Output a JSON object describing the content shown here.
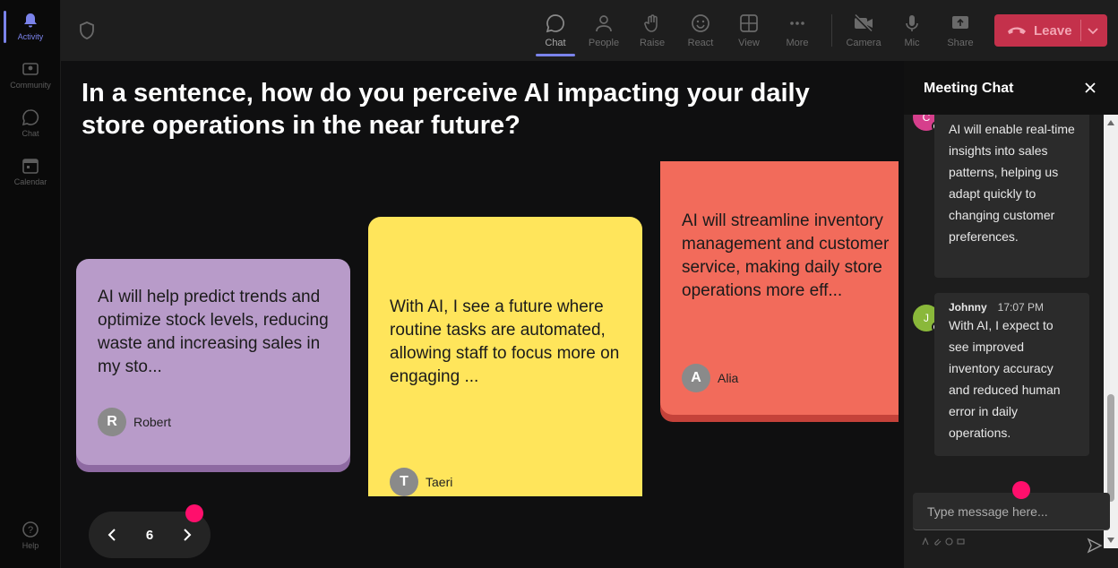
{
  "rail": {
    "items": [
      {
        "label": "Activity",
        "icon": "bell-icon"
      },
      {
        "label": "Community",
        "icon": "community-icon"
      },
      {
        "label": "Chat",
        "icon": "chat-icon"
      },
      {
        "label": "Calendar",
        "icon": "calendar-icon"
      },
      {
        "label": "Help",
        "icon": "help-icon"
      }
    ]
  },
  "topbar": {
    "buttons": [
      {
        "label": "Chat",
        "icon": "chat-icon"
      },
      {
        "label": "People",
        "icon": "people-icon"
      },
      {
        "label": "Raise",
        "icon": "raise-hand-icon"
      },
      {
        "label": "React",
        "icon": "smiley-icon"
      },
      {
        "label": "View",
        "icon": "grid-icon"
      },
      {
        "label": "More",
        "icon": "ellipsis-icon"
      },
      {
        "label": "Camera",
        "icon": "camera-off-icon"
      },
      {
        "label": "Mic",
        "icon": "mic-icon"
      },
      {
        "label": "Share",
        "icon": "share-icon"
      }
    ],
    "leave_label": "Leave"
  },
  "stage": {
    "question": "In a sentence, how do you perceive AI impacting your daily store operations in the near future?",
    "cards": [
      {
        "text": "AI will help predict trends and optimize stock levels, reducing waste and increasing sales in my sto...",
        "author": "Robert",
        "initial": "R",
        "color": "#b89bc9"
      },
      {
        "text": "With AI, I see a future where routine tasks are automated, allowing staff to focus more on engaging ...",
        "author": "Taeri",
        "initial": "T",
        "color": "#ffe55b"
      },
      {
        "text": "AI will streamline inventory management and customer service, making daily store operations more eff...",
        "author": "Alia",
        "initial": "A",
        "color": "#f26b5b"
      }
    ],
    "page_number": "6"
  },
  "chat": {
    "title": "Meeting Chat",
    "messages": [
      {
        "initial": "C",
        "avatar_color": "#d63f8c",
        "text": "AI will enable real-time insights into sales patterns, helping us adapt quickly to changing customer preferences."
      },
      {
        "initial": "J",
        "avatar_color": "#8ab83a",
        "sender": "Johnny",
        "time": "17:07 PM",
        "text": "With AI, I expect to see improved inventory accuracy and reduced human error in daily operations."
      }
    ],
    "compose_placeholder": "Type message here..."
  }
}
